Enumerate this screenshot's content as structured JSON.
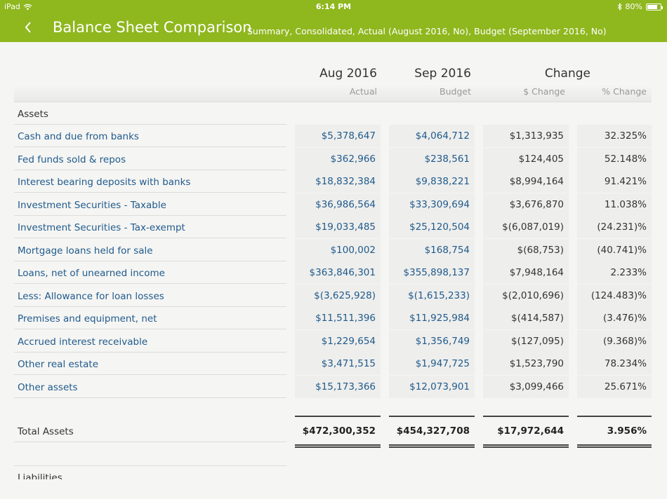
{
  "status": {
    "device": "iPad",
    "time": "6:14 PM",
    "battery": "80%",
    "battery_level": 0.8
  },
  "header": {
    "title": "Balance Sheet Comparison",
    "subtitle": "Summary, Consolidated, Actual (August 2016, No), Budget (September 2016, No)"
  },
  "columns": {
    "c1_head": "Aug 2016",
    "c1_sub": "Actual",
    "c2_head": "Sep 2016",
    "c2_sub": "Budget",
    "c3_head": "Change",
    "c3_sub": "$ Change",
    "c4_sub": "% Change"
  },
  "section": "Assets",
  "rows": [
    {
      "label": "Cash and due from banks",
      "aug": "$5,378,647",
      "sep": "$4,064,712",
      "chg": "$1,313,935",
      "pct": "32.325%"
    },
    {
      "label": "Fed funds sold & repos",
      "aug": "$362,966",
      "sep": "$238,561",
      "chg": "$124,405",
      "pct": "52.148%"
    },
    {
      "label": "Interest bearing deposits with banks",
      "aug": "$18,832,384",
      "sep": "$9,838,221",
      "chg": "$8,994,164",
      "pct": "91.421%"
    },
    {
      "label": "Investment Securities - Taxable",
      "aug": "$36,986,564",
      "sep": "$33,309,694",
      "chg": "$3,676,870",
      "pct": "11.038%"
    },
    {
      "label": "Investment Securities - Tax-exempt",
      "aug": "$19,033,485",
      "sep": "$25,120,504",
      "chg": "$(6,087,019)",
      "pct": "(24.231)%"
    },
    {
      "label": "Mortgage loans held for sale",
      "aug": "$100,002",
      "sep": "$168,754",
      "chg": "$(68,753)",
      "pct": "(40.741)%"
    },
    {
      "label": "Loans, net of unearned income",
      "aug": "$363,846,301",
      "sep": "$355,898,137",
      "chg": "$7,948,164",
      "pct": "2.233%"
    },
    {
      "label": "Less: Allowance for loan losses",
      "aug": "$(3,625,928)",
      "sep": "$(1,615,233)",
      "chg": "$(2,010,696)",
      "pct": "(124.483)%"
    },
    {
      "label": "Premises and equipment, net",
      "aug": "$11,511,396",
      "sep": "$11,925,984",
      "chg": "$(414,587)",
      "pct": "(3.476)%"
    },
    {
      "label": "Accrued interest receivable",
      "aug": "$1,229,654",
      "sep": "$1,356,749",
      "chg": "$(127,095)",
      "pct": "(9.368)%"
    },
    {
      "label": "Other real estate",
      "aug": "$3,471,515",
      "sep": "$1,947,725",
      "chg": "$1,523,790",
      "pct": "78.234%"
    },
    {
      "label": "Other assets",
      "aug": "$15,173,366",
      "sep": "$12,073,901",
      "chg": "$3,099,466",
      "pct": "25.671%"
    }
  ],
  "total": {
    "label": "Total Assets",
    "aug": "$472,300,352",
    "sep": "$454,327,708",
    "chg": "$17,972,644",
    "pct": "3.956%"
  },
  "next_section": "Liabilities",
  "colors": {
    "header": "#8fb71e",
    "link": "#1f5a8c"
  }
}
